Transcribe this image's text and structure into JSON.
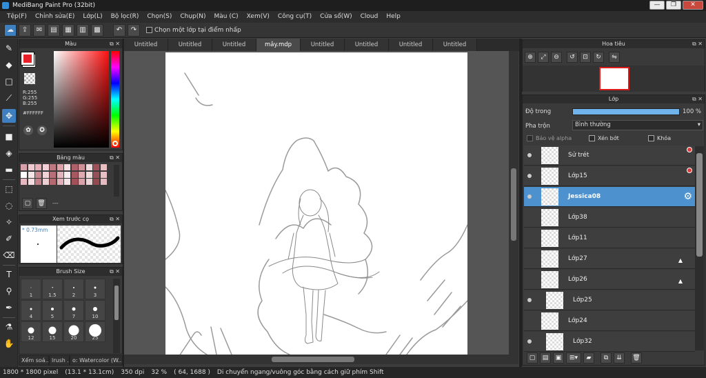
{
  "window": {
    "title": "MediBang Paint Pro (32bit)",
    "min": "—",
    "max": "❐",
    "close": "✕"
  },
  "menu": [
    "Tệp(F)",
    "Chỉnh sửa(E)",
    "Lớp(L)",
    "Bộ lọc(R)",
    "Chọn(S)",
    "Chụp(N)",
    "Màu (C)",
    "Xem(V)",
    "Công cụ(T)",
    "Cửa sổ(W)",
    "Cloud",
    "Help"
  ],
  "toolbar": {
    "checkbox_label": "Chọn một lớp tại điểm nhấp"
  },
  "color_panel": {
    "title": "Màu",
    "r": "R:255",
    "g": "G:255",
    "b": "B:255",
    "hex": "#FFFFFF",
    "primary": "#e8202a",
    "secondary": "#ffffff"
  },
  "palette_panel": {
    "title": "Bảng màu",
    "dash": "---",
    "colors": [
      "#d8a0a8",
      "#f0c8d0",
      "#e8b0b8",
      "#f4d0d8",
      "#c07880",
      "#e0a0a8",
      "#f8e0e4",
      "#b06068",
      "#d09098",
      "#f0d8dc",
      "#a05058",
      "#e8c0c4",
      "#ffffff",
      "#f6e6e8",
      "#c88890",
      "#f2d4d8",
      "#b87078",
      "#e4b4bc",
      "#f8ecee",
      "#a85860",
      "#dcaab0",
      "#f0dada",
      "#985058",
      "#e6c2c6",
      "#e8b8c0",
      "#f4dce0",
      "#c48088",
      "#eed0d4",
      "#b46870",
      "#e0b0b8",
      "#f6e4e6",
      "#a45058",
      "#d8a2aa",
      "#ecd4d6",
      "#944850",
      "#e2bcc0"
    ]
  },
  "brush_preview": {
    "title": "Xem trước cọ",
    "size": "* 0.73mm"
  },
  "brush_size": {
    "title": "Brush Size",
    "sizes": [
      {
        "label": "1",
        "d": 1
      },
      {
        "label": "1.5",
        "d": 1.5
      },
      {
        "label": "2",
        "d": 2
      },
      {
        "label": "3",
        "d": 3
      },
      {
        "label": "4",
        "d": 3
      },
      {
        "label": "5",
        "d": 4
      },
      {
        "label": "7",
        "d": 5
      },
      {
        "label": "10",
        "d": 6
      },
      {
        "label": "12",
        "d": 9
      },
      {
        "label": "15",
        "d": 11
      },
      {
        "label": "20",
        "d": 15
      },
      {
        "label": "25",
        "d": 18
      }
    ]
  },
  "bottom_tabs": [
    "Xếm soá...",
    "lrush ...",
    "o: Watercolor (W..."
  ],
  "doc_tabs": [
    "Untitled",
    "Untitled",
    "Untitled",
    "mây.mdp",
    "Untitled",
    "Untitled",
    "Untitled",
    "Untitled"
  ],
  "navigator": {
    "title": "Hoa tiêu"
  },
  "layer_panel": {
    "title": "Lớp",
    "opacity_label": "Độ trong",
    "opacity_value": "100 %",
    "opacity": 1.0,
    "blend_label": "Pha trộn",
    "blend_value": "Bình thường",
    "protect_alpha": "Bảo vệ alpha",
    "clipping": "Xén bớt",
    "lock": "Khóa",
    "layers": [
      {
        "name": "Sử trét",
        "visible": true,
        "selected": false,
        "indent": false
      },
      {
        "name": "Lớp15",
        "visible": true,
        "selected": false,
        "indent": false
      },
      {
        "name": "Jessica08",
        "visible": true,
        "selected": true,
        "indent": false
      },
      {
        "name": "Lớp38",
        "visible": false,
        "selected": false,
        "indent": false
      },
      {
        "name": "Lớp11",
        "visible": false,
        "selected": false,
        "indent": false
      },
      {
        "name": "Lớp27",
        "visible": false,
        "selected": false,
        "indent": false
      },
      {
        "name": "Lớp26",
        "visible": false,
        "selected": false,
        "indent": false
      },
      {
        "name": "Lớp25",
        "visible": true,
        "selected": false,
        "indent": true
      },
      {
        "name": "Lớp24",
        "visible": false,
        "selected": false,
        "indent": false
      },
      {
        "name": "Lớp32",
        "visible": true,
        "selected": false,
        "indent": true
      }
    ]
  },
  "status": {
    "size": "1800 * 1800 pixel",
    "cm": "(13.1 * 13.1cm)",
    "dpi": "350 dpi",
    "zoom": "32 %",
    "coords": "( 64, 1688 )",
    "hint": "Di chuyển ngang/vuông góc bằng cách giữ phím Shift"
  }
}
